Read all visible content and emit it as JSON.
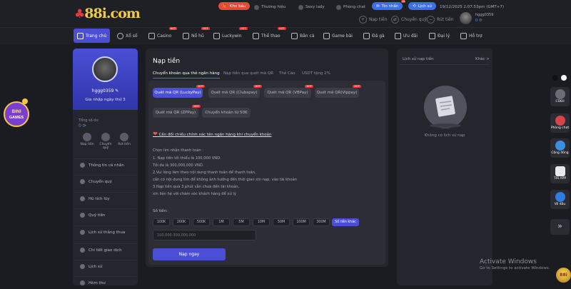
{
  "brand": {
    "logo_text": "88i.com"
  },
  "topbar": {
    "links": [
      {
        "label": "Kho báu",
        "style": "red"
      },
      {
        "label": "Thương hiệu"
      },
      {
        "label": "Sexy lady"
      },
      {
        "label": "Phòng chat"
      },
      {
        "label": "Tin nhắn",
        "style": "blue",
        "badge": "16"
      },
      {
        "label": "Lịch sử",
        "style": "blue"
      }
    ],
    "datetime": "19/12/2025 2:07:53pm (GMT+7)"
  },
  "header_actions": [
    {
      "label": "Nạp tiền"
    },
    {
      "label": "Chuyển quỹ"
    },
    {
      "label": "Rút tiền"
    }
  ],
  "user_small": {
    "name": "hggg0359",
    "balance": "0"
  },
  "nav": [
    {
      "label": "Trang chủ",
      "active": true
    },
    {
      "label": "Xổ số"
    },
    {
      "label": "Casino",
      "hot": "HOT"
    },
    {
      "label": "Nổ hũ",
      "hot": "HOT"
    },
    {
      "label": "Luckywin",
      "hot": "HOT"
    },
    {
      "label": "Thể thao",
      "hot": "HOT"
    },
    {
      "label": "Bắn cá"
    },
    {
      "label": "Game bài"
    },
    {
      "label": "Đá gà"
    },
    {
      "label": "Ưu đãi"
    },
    {
      "label": "Đại lý"
    },
    {
      "label": "Hỗ trợ"
    }
  ],
  "profile": {
    "username": "hggg0359",
    "joined": "Gia nhập ngày thứ 3",
    "balance_label": "Tổng số dư",
    "balance_value": "0",
    "quick_actions": [
      "Nạp tiền",
      "Chuyển quỹ",
      "Rút tiền"
    ]
  },
  "menu": [
    "Thông tin cá nhân",
    "Chuyển quỹ",
    "Hũ tích lũy",
    "Quỹ tiền",
    "Lịch sử thắng thua",
    "Chi tiết giao dịch",
    "Lịch sử",
    "Hòm thư"
  ],
  "deposit": {
    "title": "Nạp tiền",
    "tabs": [
      "Chuyển khoản qua thẻ ngân hàng",
      "Nạp tiền qua quét mã QR",
      "Thẻ Cào",
      "USDT tặng 2%"
    ],
    "methods": [
      {
        "label": "Quét mã QR (LuckyPay)",
        "active": true,
        "hot": "HOT"
      },
      {
        "label": "Quét mã QR (Clubspay)",
        "hot": "HOT"
      },
      {
        "label": "Quét mã QR (VBPay)",
        "hot": "HOT"
      },
      {
        "label": "Quét mã QR(Vippay)",
        "hot": "HOT"
      },
      {
        "label": "Quét mã QR (ZPPay)",
        "hot": "HOT"
      },
      {
        "label": "Chuyển khoản từ 50K"
      }
    ],
    "compare_link": "Cần đối chiếu chính xác tên ngân hàng khi chuyển khoản",
    "rules": [
      "Chọn lìm nhận thanh toán :",
      "1. Nạp tiền tối thiểu là 100,000 VND.",
      "Tối đa là 300,000,000 VND.",
      "2.Vui lòng làm theo nội dung thanh toán để thanh toán,",
      "cần có nội dung tìm để không ảnh hưởng đến thời gian xin nạp. vào tài khoản",
      "3.Nạp tiền quá 3 phút vẫn chưa đến tài khoản,",
      "xin liên hệ với chăm sóc khách hàng để xử lý"
    ],
    "amount_label": "Số tiền:",
    "amounts": [
      "100K",
      "200K",
      "500K",
      "1M",
      "5M",
      "10M",
      "50M",
      "100M",
      "300M"
    ],
    "other_amount": "Số tiền khác",
    "amount_placeholder": "100,000-300,000,000",
    "submit": "Nạp ngay"
  },
  "history": {
    "title": "Lịch sử nạp tiền",
    "more": "Khác >",
    "empty": "Không có lịch sử nạp"
  },
  "rightbar": [
    {
      "label": "CSKH"
    },
    {
      "label": "Phòng chat"
    },
    {
      "label": "Cộng đồng"
    },
    {
      "label": "TẢI APP"
    },
    {
      "label": "Vô đầu"
    }
  ],
  "windows_watermark": {
    "line1": "Activate Windows",
    "line2": "Go to Settings to activate Windows."
  },
  "promo": {
    "bingames": "BINI GAMES",
    "fab": "88i"
  },
  "colors": {
    "accent": "#4b4fd6",
    "bg": "#1b1c21",
    "panel": "#25262d",
    "hot": "#e33333"
  }
}
